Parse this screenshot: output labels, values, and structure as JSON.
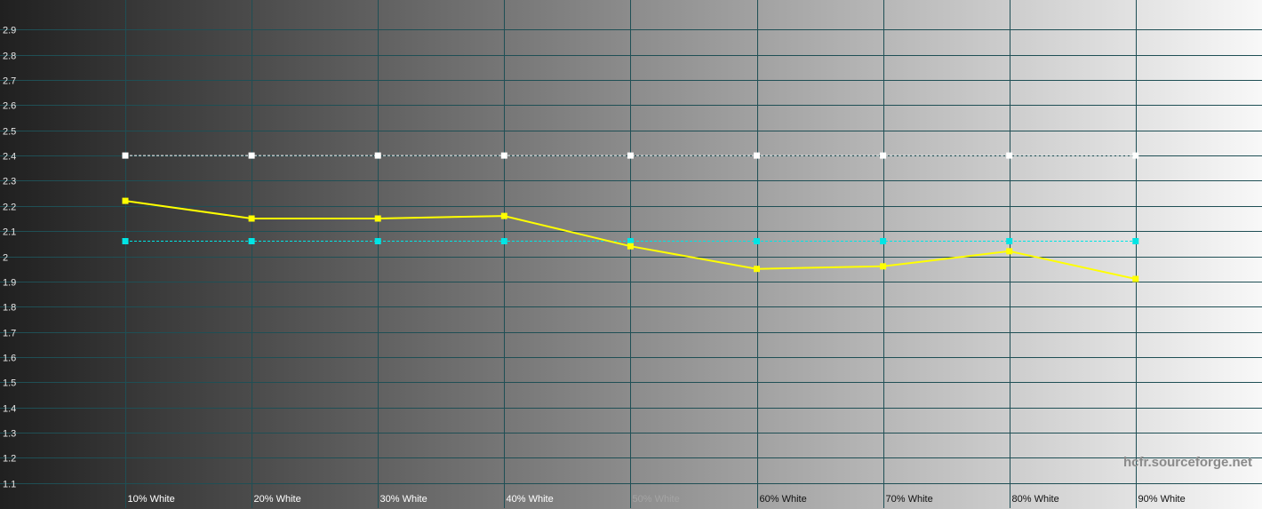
{
  "watermark": "hcfr.sourceforge.net",
  "chart_data": {
    "type": "line",
    "title": "",
    "xlabel": "",
    "ylabel": "",
    "categories": [
      "10% White",
      "20% White",
      "30% White",
      "40% White",
      "50% White",
      "60% White",
      "70% White",
      "80% White",
      "90% White"
    ],
    "ylim": [
      1.0,
      3.0
    ],
    "yticks": [
      1.1,
      1.2,
      1.3,
      1.4,
      1.5,
      1.6,
      1.7,
      1.8,
      1.9,
      2,
      2.1,
      2.2,
      2.3,
      2.4,
      2.5,
      2.6,
      2.7,
      2.8,
      2.9
    ],
    "grid": true,
    "series": [
      {
        "values": [
          2.4,
          2.4,
          2.4,
          2.4,
          2.4,
          2.4,
          2.4,
          2.4,
          2.4
        ],
        "color": "#ffffff",
        "dash": true
      },
      {
        "values": [
          2.06,
          2.06,
          2.06,
          2.06,
          2.06,
          2.06,
          2.06,
          2.06,
          2.06
        ],
        "color": "#00e5e5",
        "dash": true
      },
      {
        "values": [
          2.22,
          2.15,
          2.15,
          2.16,
          2.04,
          1.95,
          1.96,
          2.02,
          1.91
        ],
        "color": "#ffff00",
        "dash": false
      }
    ],
    "colors": {
      "grid": "#1f4f55",
      "background_dark": "#202020",
      "background_light": "#f8f8f8"
    }
  }
}
